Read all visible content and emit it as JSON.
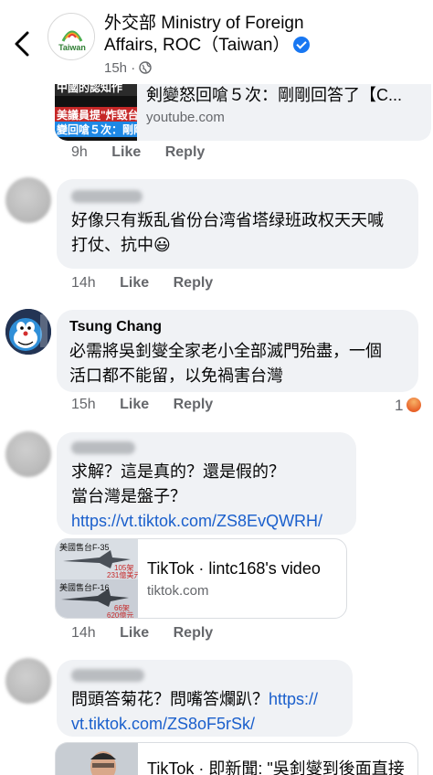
{
  "header": {
    "page_name": "外交部 Ministry of Foreign Affairs, ROC（Taiwan）",
    "page_name_line1": "外交部 Ministry of Foreign",
    "page_name_line2": "Affairs, ROC（Taiwan）",
    "timestamp": "15h",
    "avatar_caption": "Taiwan"
  },
  "yt_card": {
    "title": "剣變怒回嗆５次：剛剛回答了【C...",
    "domain": "youtube.com",
    "thumb_text_1": "中國的認知作",
    "thumb_text_2": "美議員提\"炸毀台",
    "thumb_text_3": "變回嗆５次：剛剛"
  },
  "actions": {
    "like": "Like",
    "reply": "Reply"
  },
  "comments": [
    {
      "time": "9h"
    },
    {
      "text": "好像只有叛乱省份台湾省塔绿班政权天天喊打仗、抗中😃",
      "line1": "好像只有叛乱省份台湾省塔绿班政权天天喊",
      "line2": "打仗、抗中😃",
      "time": "14h"
    },
    {
      "author": "Tsung Chang",
      "line1": "必需將吳釗燮全家老小全部滅門殆盡，一個",
      "line2": "活口都不能留，以免禍害台灣",
      "time": "15h",
      "reaction_count": "1"
    },
    {
      "line1": "求解？這是真的？還是假的？",
      "line2": "當台灣是盤子？",
      "link": "https://vt.tiktok.com/ZS8EvQWRH/",
      "time": "14h",
      "card": {
        "title": "TikTok · lintc168's video",
        "domain": "tiktok.com",
        "thumb_text_1": "美國售台F-35",
        "thumb_text_2": "105架",
        "thumb_text_3": "231億美元",
        "thumb_text_4": "美國售台F-16",
        "thumb_text_5": "66架",
        "thumb_text_6": "620億元"
      }
    },
    {
      "line1": "問頭答菊花？問嘴答爛趴？",
      "link_part1": "https://",
      "link_part2": "vt.tiktok.com/ZS8oF5rSk/",
      "card": {
        "title": "TikTok · 即新聞: \"吳釗燮到後面直接"
      }
    }
  ]
}
